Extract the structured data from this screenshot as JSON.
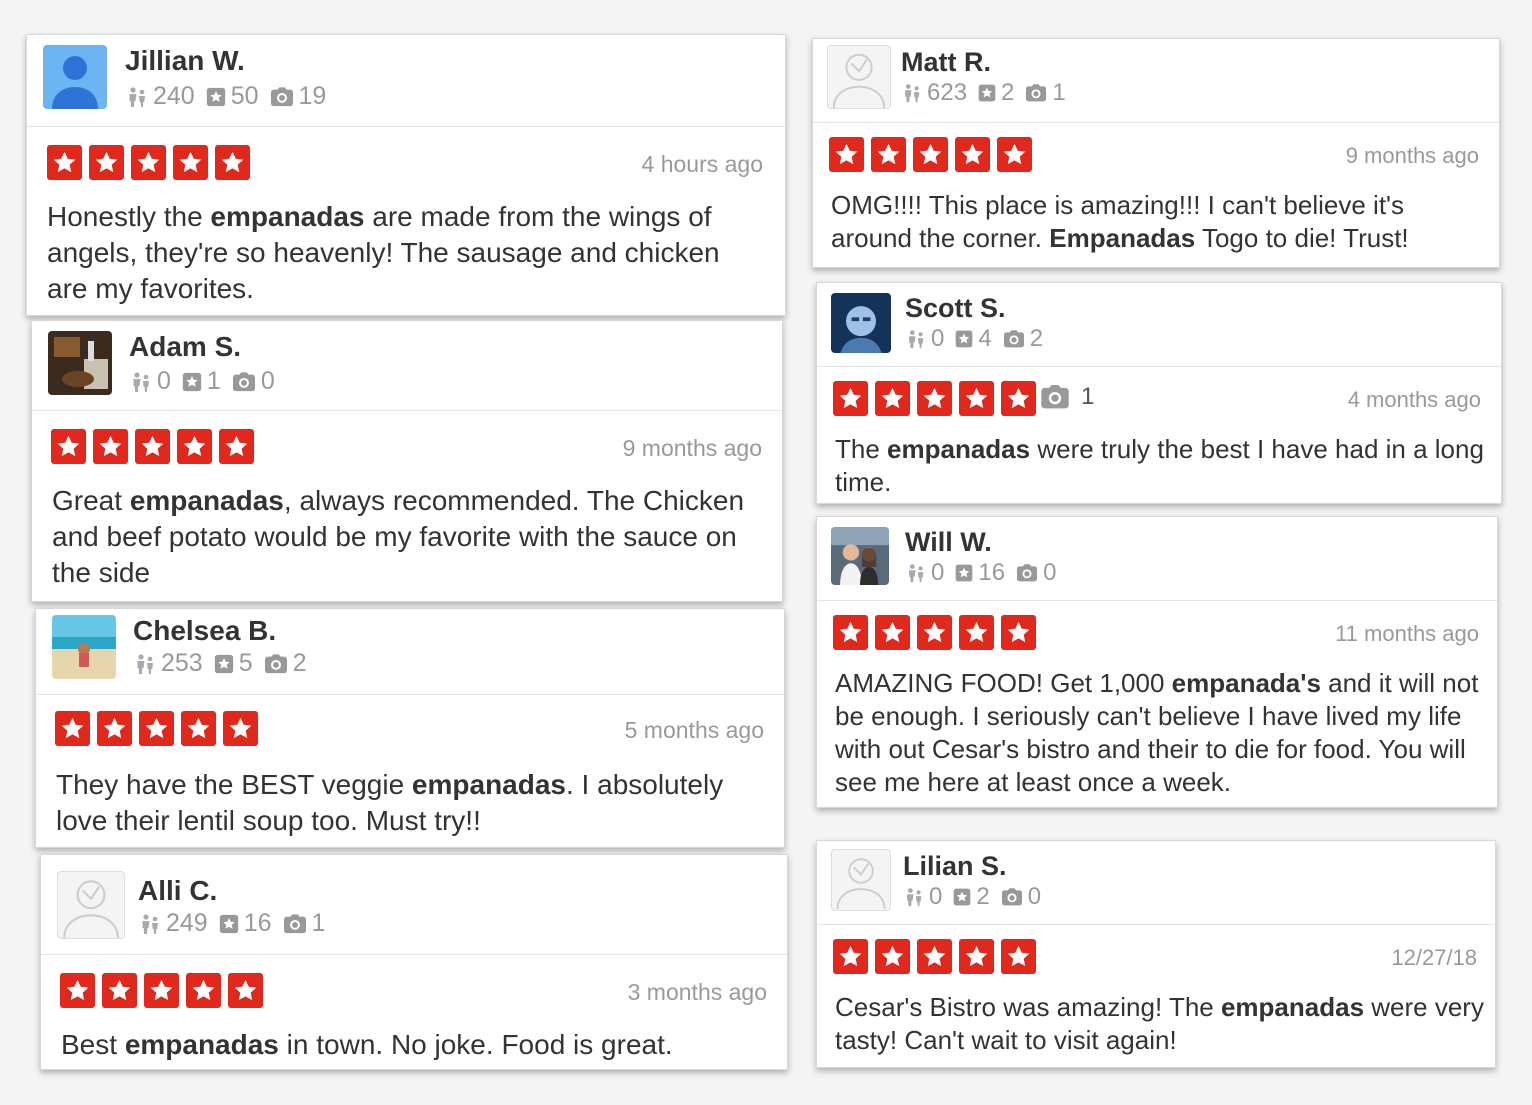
{
  "accent_color": "#e0281d",
  "reviews": [
    {
      "name": "Jillian W.",
      "avatar": "default-blue-person-icon",
      "friends": "240",
      "reviews": "50",
      "photos": "19",
      "rating": 5,
      "time": "4 hours ago",
      "text_before": "Honestly the ",
      "text_bold": "empanadas",
      "text_after": " are made from the wings of angels, they're so heavenly! The sausage and chicken are my favorites."
    },
    {
      "name": "Adam S.",
      "avatar": "photo-avatar",
      "friends": "0",
      "reviews": "1",
      "photos": "0",
      "rating": 5,
      "time": "9 months ago",
      "text_before": "Great ",
      "text_bold": "empanadas",
      "text_after": ", always recommended. The Chicken and beef potato would be my favorite with the sauce on the side"
    },
    {
      "name": "Chelsea B.",
      "avatar": "beach-photo-avatar",
      "friends": "253",
      "reviews": "5",
      "photos": "2",
      "rating": 5,
      "time": "5 months ago",
      "text_before": "They have the BEST veggie ",
      "text_bold": "empanadas",
      "text_after": ". I absolutely love their lentil soup too. Must try!!"
    },
    {
      "name": "Alli C.",
      "avatar": "default-gray-person-icon",
      "friends": "249",
      "reviews": "16",
      "photos": "1",
      "rating": 5,
      "time": "3 months ago",
      "text_before": "Best ",
      "text_bold": "empanadas",
      "text_after": " in town. No joke. Food is great."
    },
    {
      "name": "Matt R.",
      "avatar": "default-gray-person-icon",
      "friends": "623",
      "reviews": "2",
      "photos": "1",
      "rating": 5,
      "time": "9 months ago",
      "text_before": "OMG!!!! This place is amazing!!! I can't believe it's around the corner. ",
      "text_bold": "Empanadas",
      "text_after": " Togo to die! Trust!"
    },
    {
      "name": "Scott S.",
      "avatar": "robot-photo-avatar",
      "friends": "0",
      "reviews": "4",
      "photos": "2",
      "rating": 5,
      "time": "4 months ago",
      "review_photos": "1",
      "text_before": "The ",
      "text_bold": "empanadas",
      "text_after": " were truly the best I have had in a long time."
    },
    {
      "name": "Will W.",
      "avatar": "couple-photo-avatar",
      "friends": "0",
      "reviews": "16",
      "photos": "0",
      "rating": 5,
      "time": "11 months ago",
      "text_before": "AMAZING FOOD! Get 1,000 ",
      "text_bold": "empanada's",
      "text_after": " and it will not be enough. I seriously can't believe I have lived my life with out Cesar's bistro and their to die for food. You will see me here at least once a week."
    },
    {
      "name": "Lilian S.",
      "avatar": "default-gray-person-icon",
      "friends": "0",
      "reviews": "2",
      "photos": "0",
      "rating": 5,
      "time": "12/27/18",
      "text_before": "Cesar's Bistro was amazing! The ",
      "text_bold": "empanadas",
      "text_after": " were very tasty! Can't wait to visit again!"
    }
  ]
}
